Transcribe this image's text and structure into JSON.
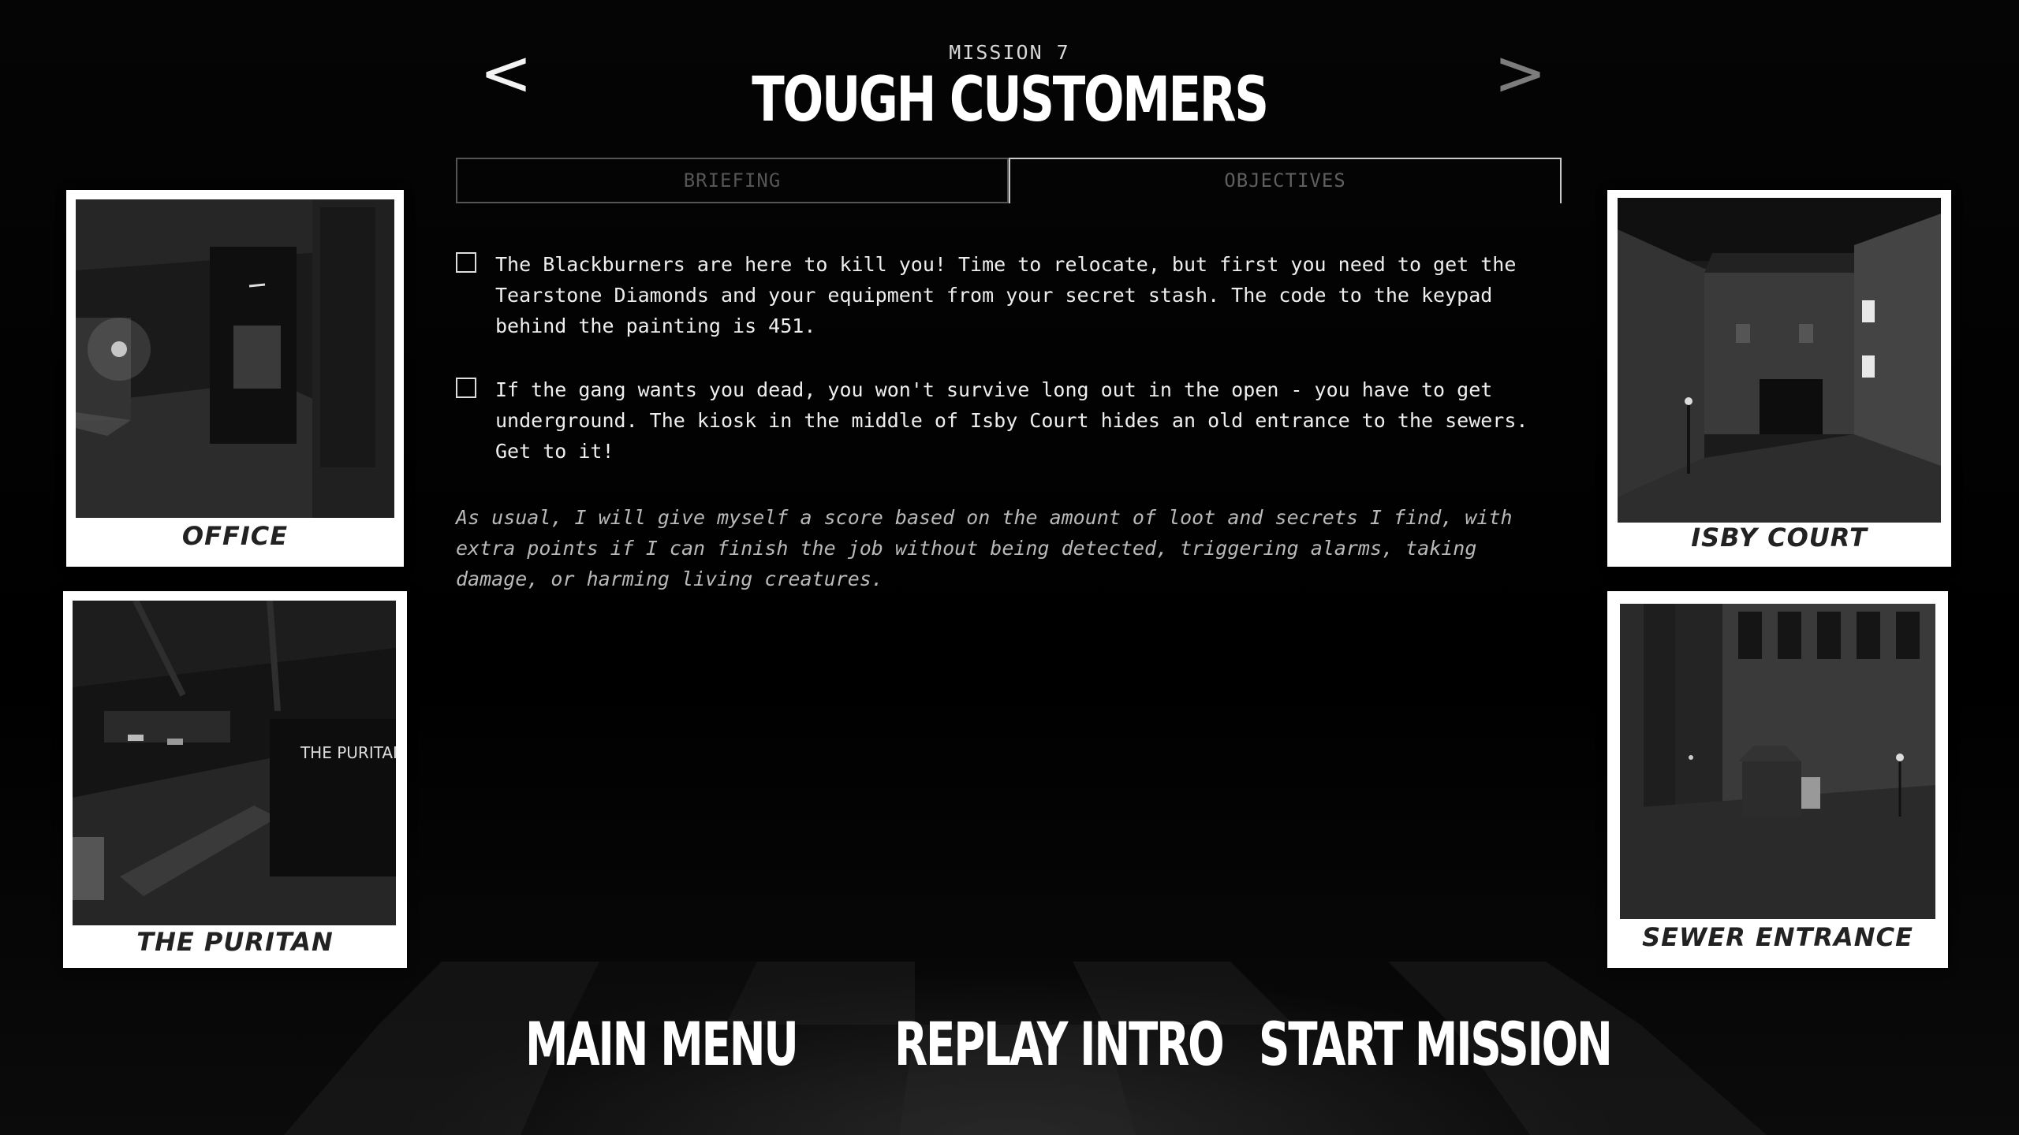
{
  "header": {
    "mission_number": "MISSION 7",
    "mission_title": "TOUGH CUSTOMERS",
    "prev_arrow": "<",
    "next_arrow": ">"
  },
  "tabs": [
    {
      "label": "BRIEFING",
      "active": false
    },
    {
      "label": "OBJECTIVES",
      "active": true
    }
  ],
  "objectives": [
    {
      "text": "The Blackburners are here to kill you! Time to relocate, but first you need to get the Tearstone Diamonds and your equipment from your secret stash. The code to the keypad behind the painting is 451.",
      "checked": false
    },
    {
      "text": "If the gang wants you dead, you won't survive long out in the open - you have to get underground. The kiosk in the middle of Isby Court hides an old entrance to the sewers. Get to it!",
      "checked": false
    }
  ],
  "note": "As usual, I will give myself a score based on the amount of loot and secrets I find, with extra points if I can finish the job without being detected, triggering alarms, taking damage, or harming living creatures.",
  "photos": {
    "office": "OFFICE",
    "puritan": "THE PURITAN",
    "isby": "ISBY COURT",
    "sewer": "SEWER ENTRANCE",
    "puritan_sign": "THE PURITAN"
  },
  "buttons": {
    "main_menu": "MAIN MENU",
    "replay_intro": "REPLAY INTRO",
    "start_mission": "START MISSION"
  },
  "colors": {
    "background": "#000000",
    "text": "#eeeeee",
    "tab_inactive": "#555555",
    "polaroid": "#ffffff"
  }
}
